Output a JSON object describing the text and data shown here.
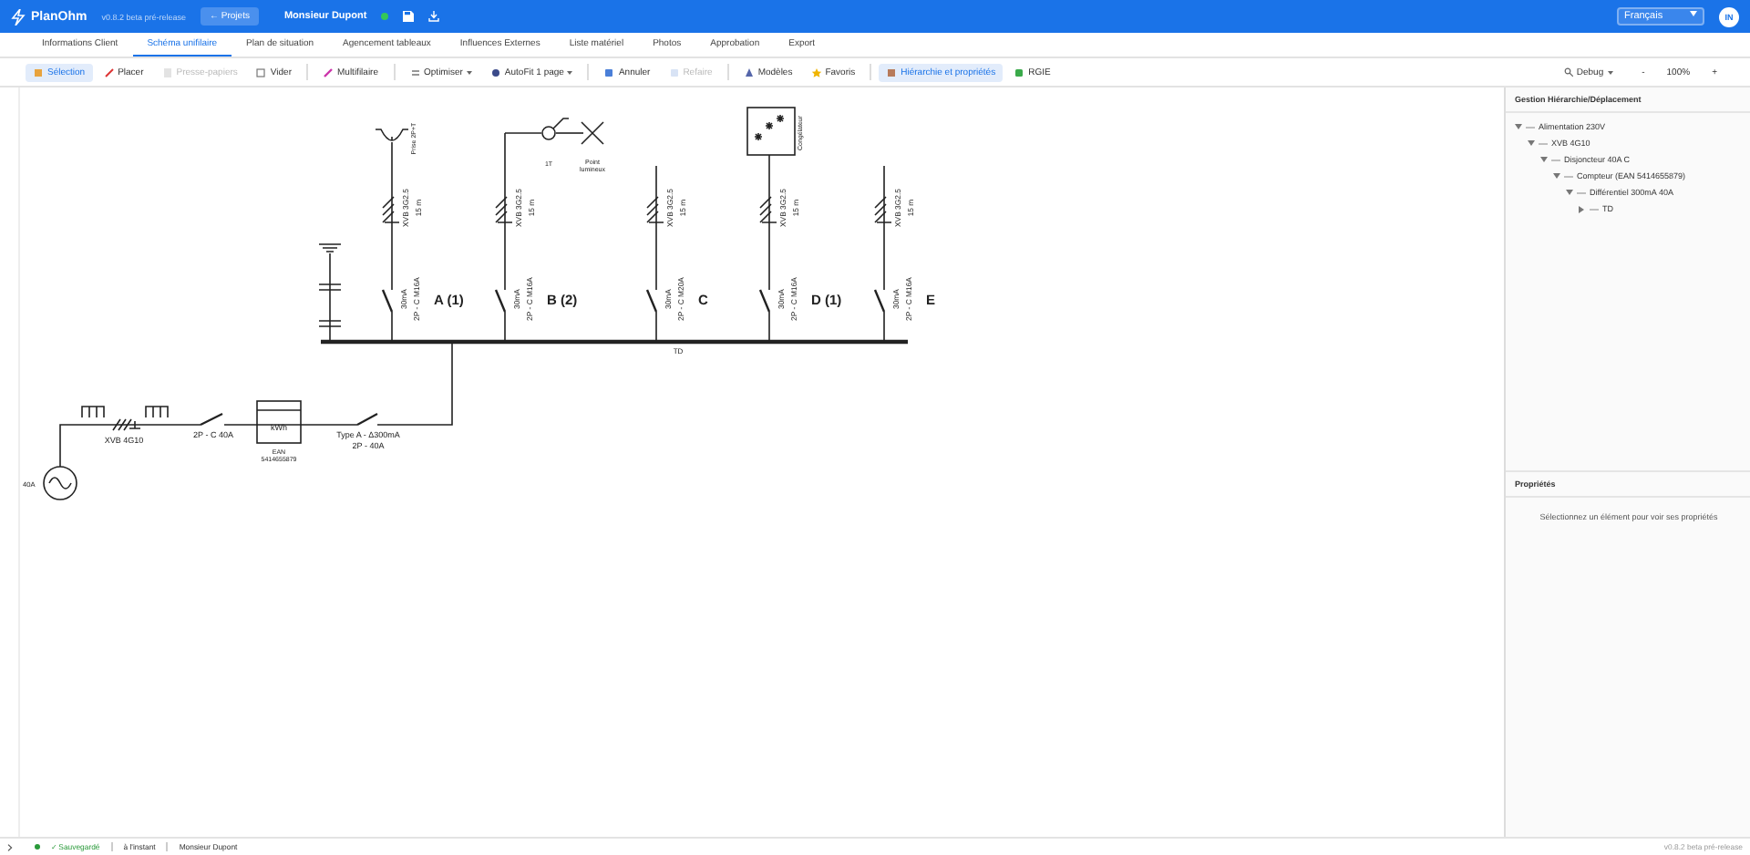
{
  "app": {
    "name": "PlanOhm",
    "version": "v0.8.2 beta pré-release",
    "back_button": "← Projets",
    "project": "Monsieur Dupont",
    "saved": true,
    "language": "Français",
    "avatar": "IN"
  },
  "tabs": [
    {
      "label": "Informations Client",
      "selected": false
    },
    {
      "label": "Schéma unifilaire",
      "selected": true
    },
    {
      "label": "Plan de situation",
      "selected": false
    },
    {
      "label": "Agencement tableaux",
      "selected": false
    },
    {
      "label": "Influences Externes",
      "selected": false
    },
    {
      "label": "Liste matériel",
      "selected": false
    },
    {
      "label": "Photos",
      "selected": false
    },
    {
      "label": "Approbation",
      "selected": false
    },
    {
      "label": "Export",
      "selected": false
    }
  ],
  "toolbar": [
    {
      "label": "Sélection",
      "kind": "button",
      "selected": true,
      "disabled": false
    },
    {
      "label": "Placer",
      "kind": "button",
      "selected": false,
      "disabled": false
    },
    {
      "label": "Presse-papiers",
      "kind": "button",
      "selected": false,
      "disabled": true
    },
    {
      "label": "Vider",
      "kind": "button",
      "selected": false,
      "disabled": false
    },
    {
      "label": "Multifilaire",
      "kind": "button",
      "selected": false,
      "disabled": false
    },
    {
      "label": "Optimiser",
      "kind": "dropdown",
      "selected": false,
      "disabled": false
    },
    {
      "label": "AutoFit 1 page",
      "kind": "dropdown",
      "selected": false,
      "disabled": false
    },
    {
      "label": "Annuler",
      "kind": "button",
      "selected": false,
      "disabled": false
    },
    {
      "label": "Refaire",
      "kind": "button",
      "selected": false,
      "disabled": true
    },
    {
      "label": "Modèles",
      "kind": "button",
      "selected": false,
      "disabled": false
    },
    {
      "label": "Favoris",
      "kind": "button",
      "selected": false,
      "disabled": false
    },
    {
      "label": "Hiérarchie et propriétés",
      "kind": "button",
      "selected": true,
      "disabled": false
    },
    {
      "label": "RGIE",
      "kind": "button",
      "selected": false,
      "disabled": false
    }
  ],
  "view": {
    "debug": "Debug",
    "zoom_out": "-",
    "zoom": "100%",
    "zoom_in": "+"
  },
  "schema": {
    "board": "TD",
    "supply": {
      "rating": "40A",
      "cable": "XVB 4G10",
      "breaker": "2P - C 40A",
      "meter_unit": "kWh",
      "meter_ean": "EAN",
      "meter_number": "5414655879",
      "differential": "Type A - Δ300mA",
      "differential_rating": "2P - 40A"
    },
    "circuits": [
      {
        "name": "A (1)",
        "kind": "socket",
        "load_label": "Prise 2P+T",
        "cable": "XVB 3G2.5",
        "length": "15 m",
        "rcd": "30mA",
        "breaker": "2P - C M16A"
      },
      {
        "name": "B (2)",
        "kind": "light",
        "switch_label": "1T",
        "load_label": "Point lumineux",
        "cable": "XVB 3G2.5",
        "length": "15 m",
        "rcd": "30mA",
        "breaker": "2P - C M16A"
      },
      {
        "name": "C",
        "kind": "none",
        "cable": "XVB 3G2.5",
        "length": "15 m",
        "rcd": "30mA",
        "breaker": "2P - C M20A"
      },
      {
        "name": "D (1)",
        "kind": "freezer",
        "load_label": "Congélateur",
        "cable": "XVB 3G2.5",
        "length": "15 m",
        "rcd": "30mA",
        "breaker": "2P - C M16A"
      },
      {
        "name": "E",
        "kind": "none",
        "cable": "XVB 3G2.5",
        "length": "15 m",
        "rcd": "30mA",
        "breaker": "2P - C M16A"
      }
    ]
  },
  "hierarchy": {
    "title": "Gestion Hiérarchie/Déplacement",
    "tree": [
      {
        "label": "Alimentation 230V",
        "expanded": true,
        "children": [
          {
            "label": "XVB 4G10",
            "expanded": true,
            "children": [
              {
                "label": "Disjoncteur 40A C",
                "expanded": true,
                "children": [
                  {
                    "label": "Compteur (EAN 5414655879)",
                    "expanded": true,
                    "children": [
                      {
                        "label": "Différentiel 300mA 40A",
                        "expanded": true,
                        "children": [
                          {
                            "label": "TD",
                            "expanded": false
                          }
                        ]
                      }
                    ]
                  }
                ]
              }
            ]
          }
        ]
      }
    ]
  },
  "properties": {
    "title": "Propriétés",
    "empty_message": "Sélectionnez un élément pour voir ses propriétés"
  },
  "status_bar": {
    "saved": "✓ Sauvegardé",
    "time": "à l'instant",
    "project": "Monsieur Dupont",
    "version": "v0.8.2 beta pré-release"
  }
}
